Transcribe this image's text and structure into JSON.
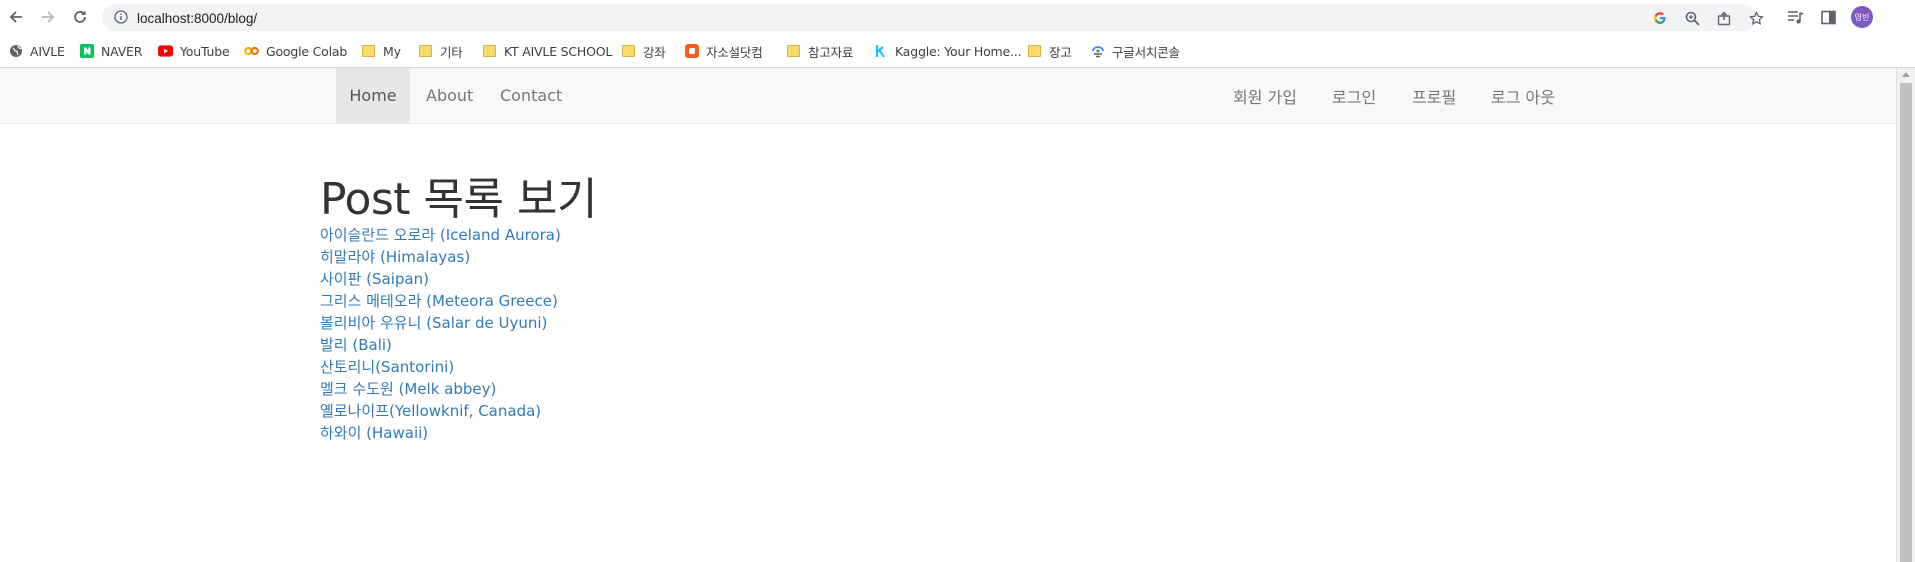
{
  "browser": {
    "url": "localhost:8000/blog/",
    "profile_initials": "영빈",
    "bookmarks": [
      {
        "label": "AIVLE",
        "icon": "globe-icon"
      },
      {
        "label": "NAVER",
        "icon": "naver-icon"
      },
      {
        "label": "YouTube",
        "icon": "youtube-icon"
      },
      {
        "label": "Google Colab",
        "icon": "colab-icon"
      },
      {
        "label": "My",
        "icon": "folder-icon"
      },
      {
        "label": "기타",
        "icon": "folder-icon"
      },
      {
        "label": "KT AIVLE SCHOOL",
        "icon": "folder-icon"
      },
      {
        "label": "강좌",
        "icon": "folder-icon"
      },
      {
        "label": "자소설닷컴",
        "icon": "jasoseol-icon"
      },
      {
        "label": "참고자료",
        "icon": "folder-icon"
      },
      {
        "label": "Kaggle: Your Home...",
        "icon": "kaggle-icon"
      },
      {
        "label": "장고",
        "icon": "folder-icon"
      },
      {
        "label": "구글서치콘솔",
        "icon": "search-console-icon"
      }
    ]
  },
  "navbar": {
    "left": [
      "Home",
      "About",
      "Contact"
    ],
    "right": [
      "회원 가입",
      "로그인",
      "프로필",
      "로그 아웃"
    ],
    "active": "Home"
  },
  "page": {
    "title": "Post 목록 보기",
    "posts": [
      "아이슬란드 오로라 (Iceland Aurora)",
      "히말라야 (Himalayas)",
      "사이판 (Saipan)",
      "그리스 메테오라 (Meteora Greece)",
      "볼리비아 우유니 (Salar de Uyuni)",
      "발리 (Bali)",
      "산토리니(Santorini)",
      "멜크 수도원 (Melk abbey)",
      "옐로나이프(Yellowknif, Canada)",
      "하와이 (Hawaii)"
    ]
  },
  "colors": {
    "link": "#337ab7",
    "navbar_bg": "#f8f8f8",
    "active_nav_bg": "#e7e7e7",
    "profile": "#7e57c2"
  }
}
